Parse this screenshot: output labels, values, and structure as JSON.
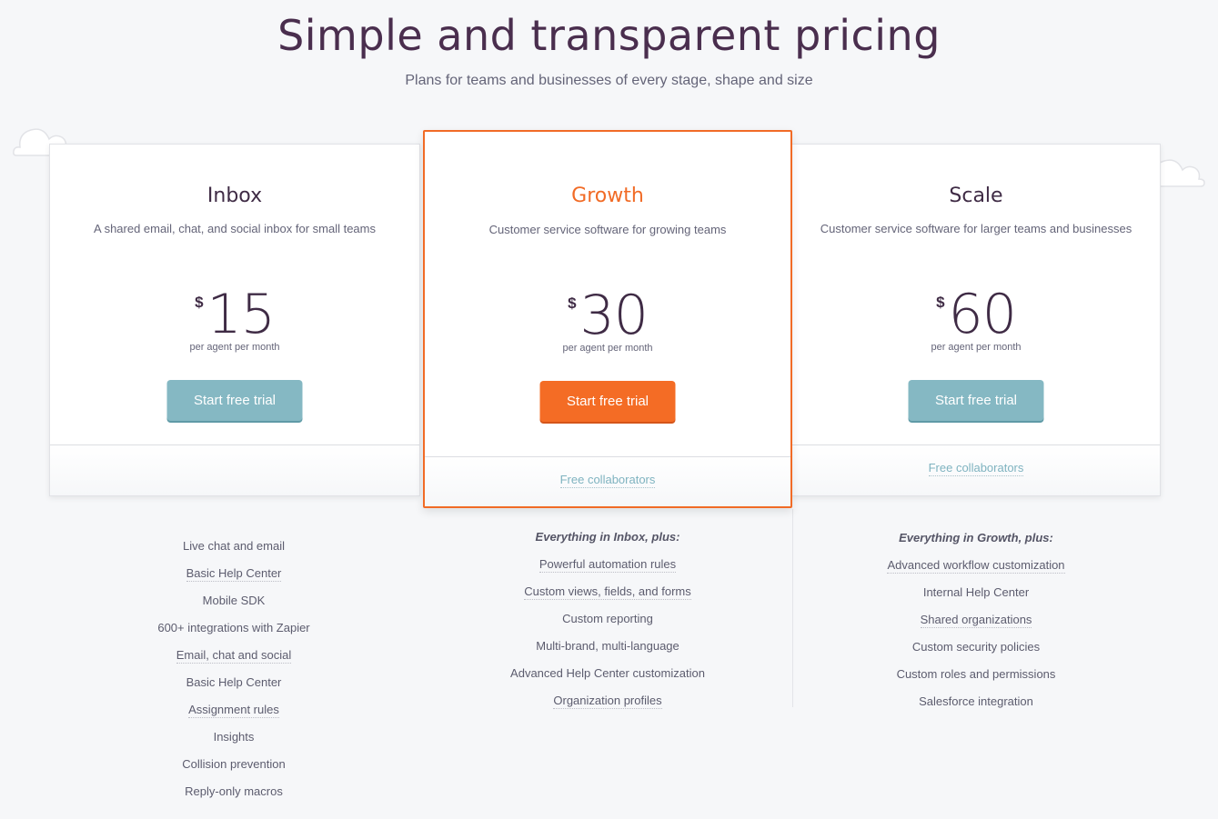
{
  "header": {
    "title": "Simple and transparent pricing",
    "subtitle": "Plans for teams and businesses of every stage, shape and size"
  },
  "colors": {
    "accent": "#f16b26",
    "teal": "#85b8c3",
    "heading": "#3f2b45",
    "background": "#f6f7f9"
  },
  "plans": [
    {
      "name": "Inbox",
      "description": "A shared email, chat, and social inbox for small teams",
      "currency": "$",
      "price": "15",
      "price_unit": "per agent per month",
      "cta_label": "Start free trial",
      "footer_link": "",
      "features_heading": "",
      "features": [
        {
          "label": "Live chat and email",
          "dotted": false
        },
        {
          "label": "Basic Help Center",
          "dotted": true
        },
        {
          "label": "Mobile SDK",
          "dotted": false
        },
        {
          "label": "600+ integrations with Zapier",
          "dotted": false
        },
        {
          "label": "Email, chat and social",
          "dotted": true
        },
        {
          "label": "Basic Help Center",
          "dotted": false
        },
        {
          "label": "Assignment rules",
          "dotted": true
        },
        {
          "label": "Insights",
          "dotted": false
        },
        {
          "label": "Collision prevention",
          "dotted": false
        },
        {
          "label": "Reply-only macros",
          "dotted": false
        }
      ]
    },
    {
      "name": "Growth",
      "description": "Customer service software for growing teams",
      "currency": "$",
      "price": "30",
      "price_unit": "per agent per month",
      "cta_label": "Start free trial",
      "footer_link": "Free collaborators",
      "features_heading": "Everything in Inbox, plus:",
      "features": [
        {
          "label": "Powerful automation rules",
          "dotted": true
        },
        {
          "label": "Custom views, fields, and forms",
          "dotted": true
        },
        {
          "label": "Custom reporting",
          "dotted": false
        },
        {
          "label": "Multi-brand, multi-language",
          "dotted": false
        },
        {
          "label": "Advanced Help Center customization",
          "dotted": false
        },
        {
          "label": "Organization profiles",
          "dotted": true
        }
      ]
    },
    {
      "name": "Scale",
      "description": "Customer service software for larger teams and businesses",
      "currency": "$",
      "price": "60",
      "price_unit": "per agent per month",
      "cta_label": "Start free trial",
      "footer_link": "Free collaborators",
      "features_heading": "Everything in Growth, plus:",
      "features": [
        {
          "label": "Advanced workflow customization",
          "dotted": true
        },
        {
          "label": "Internal Help Center",
          "dotted": false
        },
        {
          "label": "Shared organizations",
          "dotted": true
        },
        {
          "label": "Custom security policies",
          "dotted": false
        },
        {
          "label": "Custom roles and permissions",
          "dotted": false
        },
        {
          "label": "Salesforce integration",
          "dotted": false
        }
      ]
    }
  ]
}
